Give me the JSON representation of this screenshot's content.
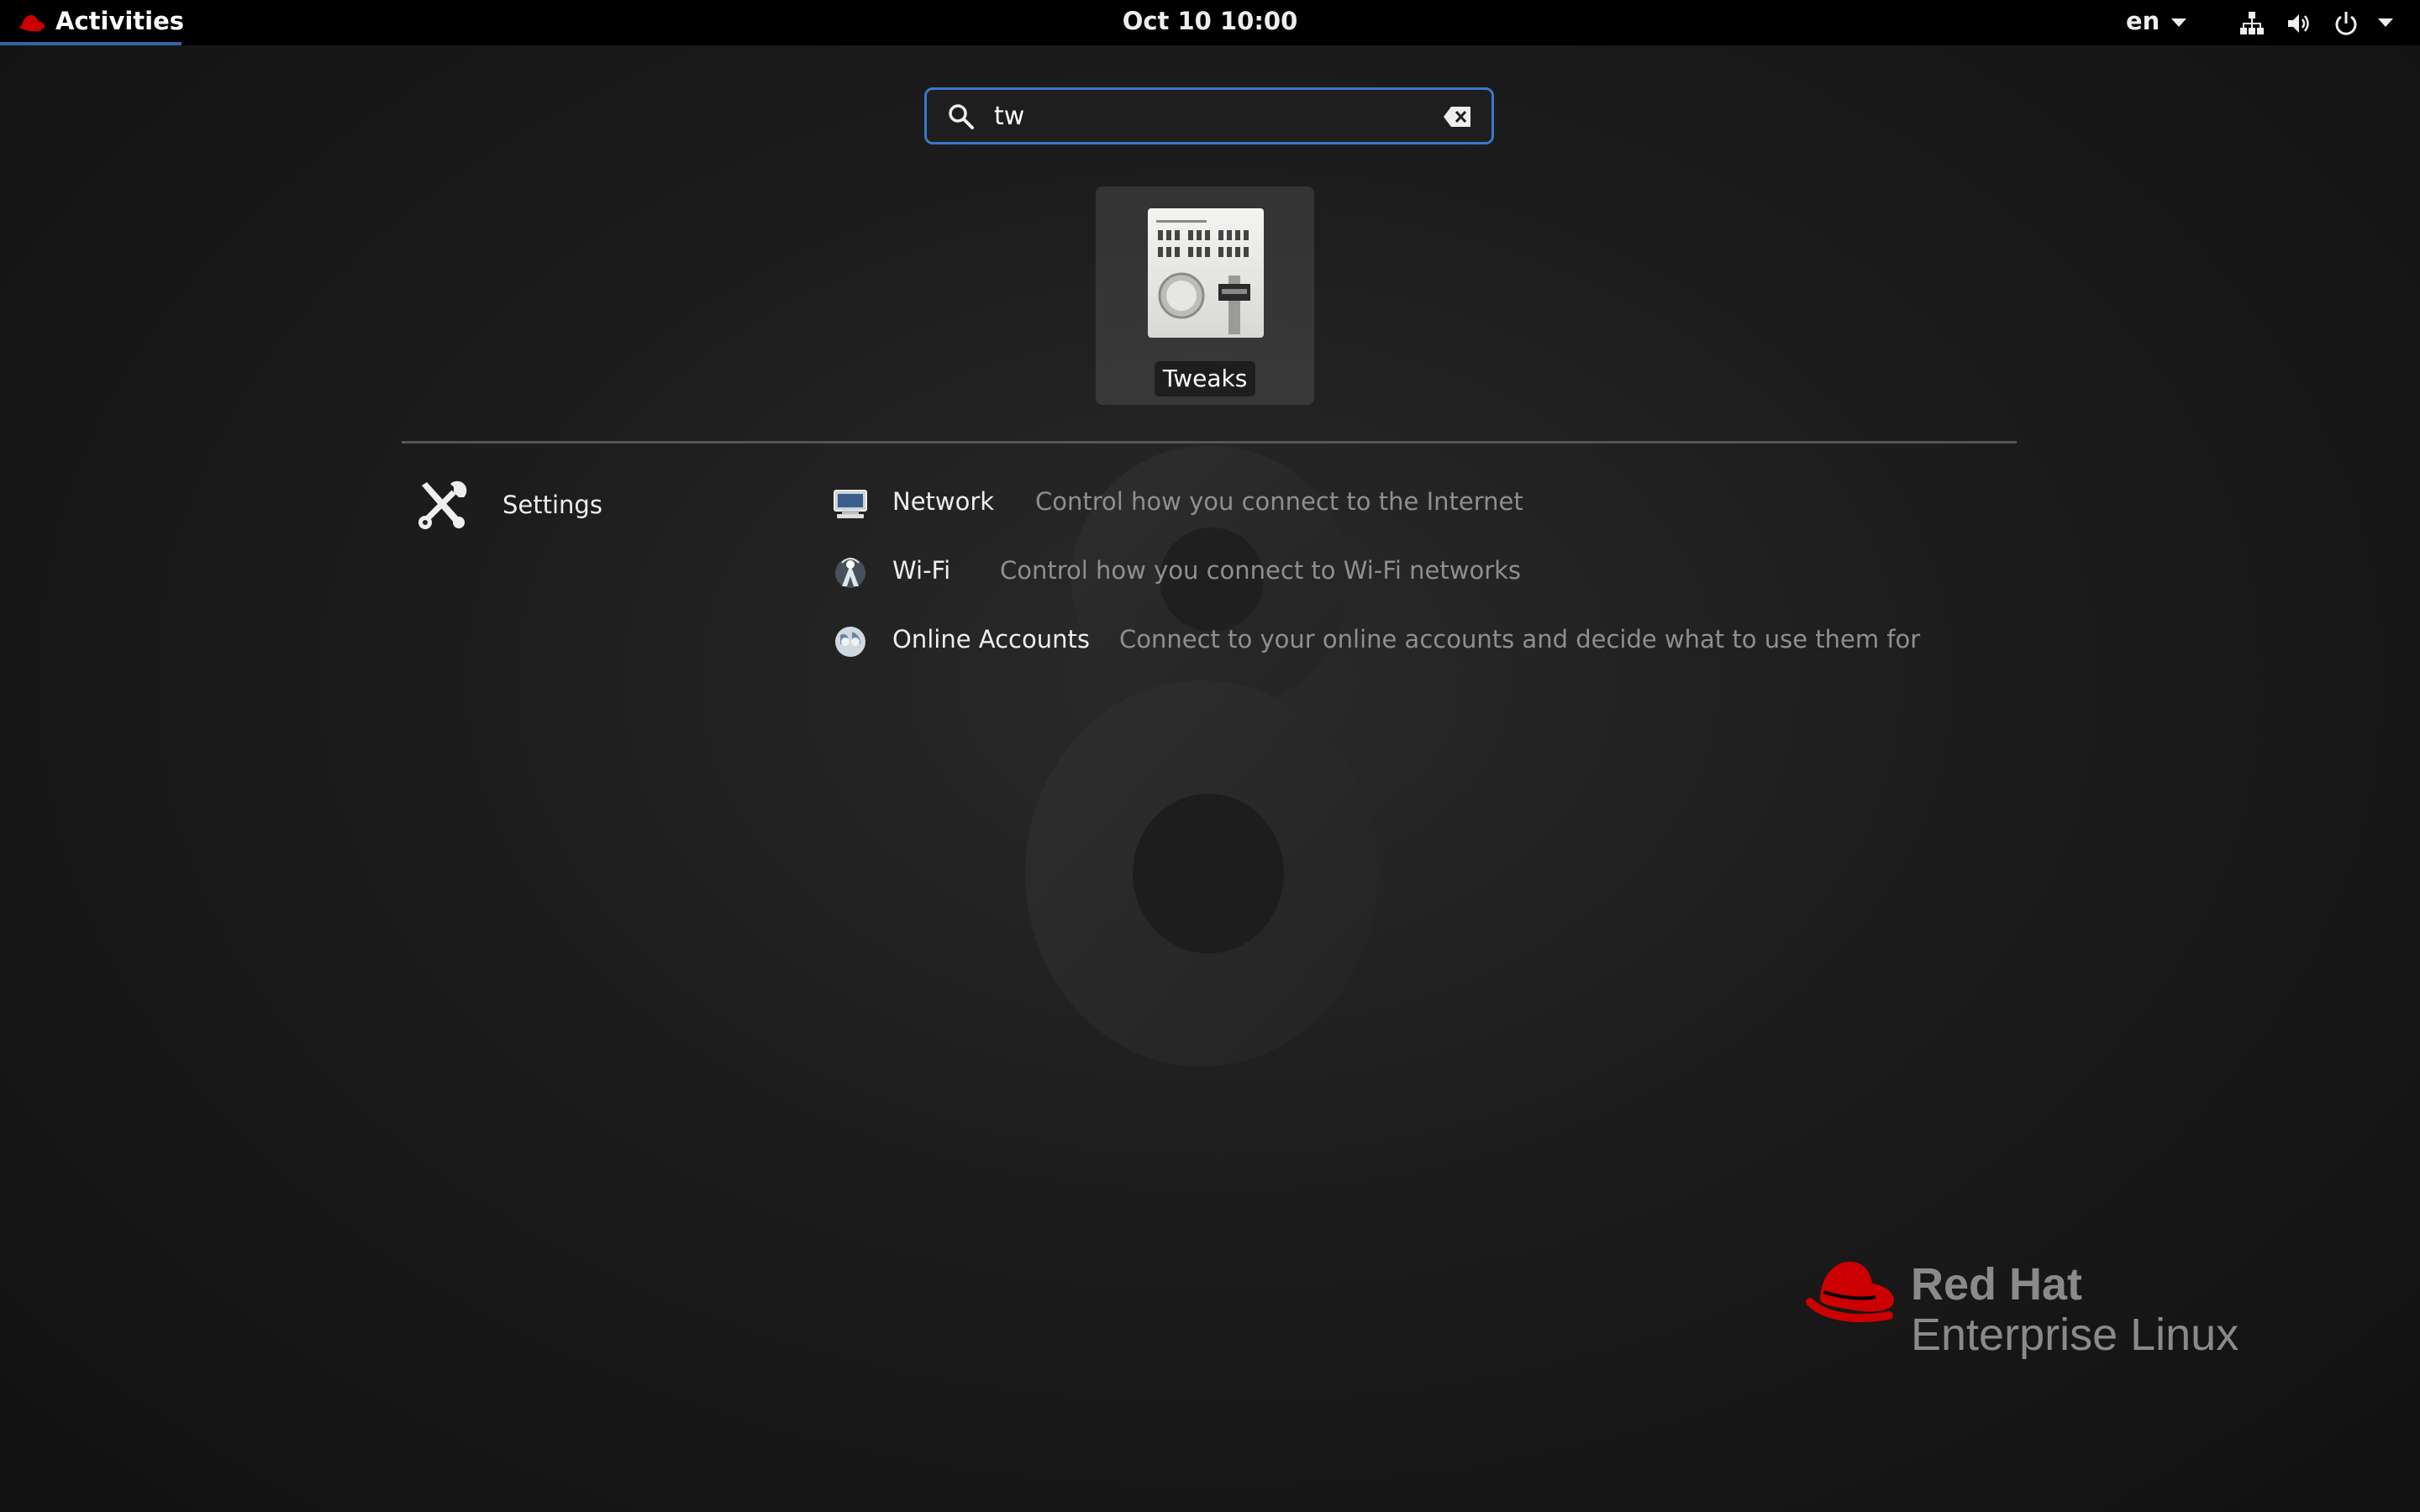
{
  "topbar": {
    "activities_label": "Activities",
    "clock": "Oct 10  10:00",
    "language": "en",
    "icons": [
      "redhat-icon",
      "network-wired-icon",
      "volume-icon",
      "power-icon"
    ]
  },
  "search": {
    "value": "tw",
    "icon": "search-icon",
    "clear_icon": "clear-text-icon"
  },
  "app_results": [
    {
      "label": "Tweaks",
      "icon": "tweaks-icon"
    }
  ],
  "provider": {
    "label": "Settings",
    "icon": "settings-tools-icon"
  },
  "settings_results": [
    {
      "title": "Network",
      "description": "Control how you connect to the Internet",
      "icon": "network-icon"
    },
    {
      "title": "Wi-Fi",
      "description": "Control how you connect to Wi-Fi networks",
      "icon": "wifi-icon"
    },
    {
      "title": "Online Accounts",
      "description": "Connect to your online accounts and decide what to use them for",
      "icon": "online-accounts-icon"
    }
  ],
  "branding": {
    "line1": "Red Hat",
    "line2": "Enterprise Linux"
  },
  "colors": {
    "accent": "#3b78c8",
    "redhat_red": "#cc0000",
    "topbar": "#000000"
  }
}
